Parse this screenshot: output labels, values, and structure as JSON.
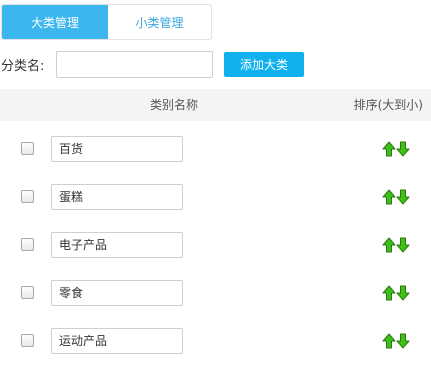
{
  "tabs": [
    {
      "label": "大类管理",
      "active": true
    },
    {
      "label": "小类管理",
      "active": false
    }
  ],
  "add_form": {
    "label": "分类名:",
    "input_value": "",
    "button_label": "添加大类"
  },
  "table": {
    "headers": {
      "name": "类别名称",
      "sort": "排序(大到小)"
    },
    "rows": [
      {
        "checked": false,
        "name": "百货"
      },
      {
        "checked": false,
        "name": "蛋糕"
      },
      {
        "checked": false,
        "name": "电子产品"
      },
      {
        "checked": false,
        "name": "零食"
      },
      {
        "checked": false,
        "name": "运动产品"
      }
    ]
  },
  "colors": {
    "tab_active_bg": "#3cb6ef",
    "button_bg": "#10b0ee",
    "arrow_fill": "#3fbf1a",
    "arrow_stroke": "#2a7a0c"
  }
}
